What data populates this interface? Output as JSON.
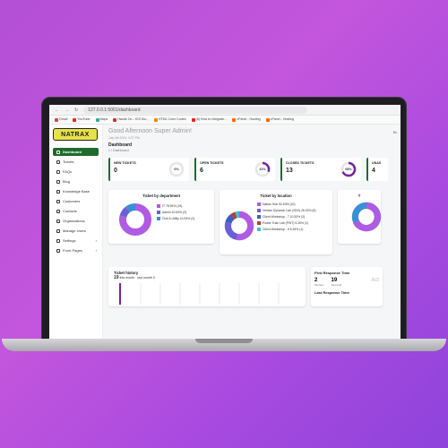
{
  "browser": {
    "url": "127.0.0.1:5001/dashboard",
    "bookmarks": [
      "Gmail",
      "YouTube",
      "Maps",
      "Hands On - IOS Mo...",
      "HTML Color Codes",
      "(8) How to Integrate...",
      "cPanel - Hosting",
      "cPanel - Hosting"
    ]
  },
  "logo": "NATRAX",
  "sidebar": {
    "items": [
      {
        "label": "Dashboard"
      },
      {
        "label": "Tickets"
      },
      {
        "label": "FAQs"
      },
      {
        "label": "Blog"
      },
      {
        "label": "Knowledge Base"
      },
      {
        "label": "Customers"
      },
      {
        "label": "Contacts"
      },
      {
        "label": "Organizations"
      },
      {
        "label": "Manage Users"
      },
      {
        "label": "Settings",
        "chevron": "›"
      },
      {
        "label": "Front Pages",
        "chevron": "›"
      }
    ]
  },
  "header": {
    "greeting": "Good Afternoon Super Admin!",
    "date": "July 4th 2024, 4:37 PM",
    "title": "Dashboard",
    "breadcrumb": "⌂  /  Dashboard",
    "flag": "Br"
  },
  "stats": [
    {
      "label": "NEW TICKETS",
      "value": "0",
      "percent": "0%",
      "fraction": 0
    },
    {
      "label": "OPEN TICKETS",
      "value": "6",
      "percent": "31%",
      "fraction": 0.31
    },
    {
      "label": "CLOSED TICKETS",
      "value": "13",
      "percent": "68%",
      "fraction": 0.68
    },
    {
      "label": "UNAS",
      "value": "4"
    }
  ],
  "dept": {
    "title": "Ticket by department",
    "items": [
      {
        "label": "IT 78.95% (15)",
        "color": "#b05be3",
        "value": 78.95
      },
      {
        "label": "Admin 10.53% (2)",
        "color": "#6b5fd8",
        "value": 10.53
      },
      {
        "label": "Civil & Utility 10.53% (2)",
        "color": "#3a8fd6",
        "value": 10.53
      }
    ]
  },
  "location": {
    "title": "Ticket by location",
    "items": [
      {
        "label": "Natrax Hub 52.63% (10)",
        "color": "#b05be3",
        "value": 52.63
      },
      {
        "label": "Vehicle Dynamic Lab (VDH) 26.32% (5)",
        "color": "#6b5fd8",
        "value": 26.32
      },
      {
        "label": "Client Workshop - 7 10.53% (2)",
        "color": "#3a5fbf",
        "value": 10.53
      },
      {
        "label": "Power Train Lab (PWT) 5.26% (1)",
        "color": "#c0392b",
        "value": 5.26
      },
      {
        "label": "Client Workshop - 5 5.26% (1)",
        "color": "#3fc1d6",
        "value": 5.26
      }
    ]
  },
  "third_title": "T",
  "history": {
    "title": "Ticket history",
    "count": "19",
    "sub": "this month",
    "sub2": "last month 0"
  },
  "response": {
    "first_title": "First Response Time",
    "first_a": "2",
    "first_a_unit": "Minutes",
    "first_b": "19",
    "first_b_unit": "Seconds",
    "side": "Act",
    "last_title": "Last Response Time"
  },
  "colors": {
    "accent": "#1e6b2c"
  }
}
